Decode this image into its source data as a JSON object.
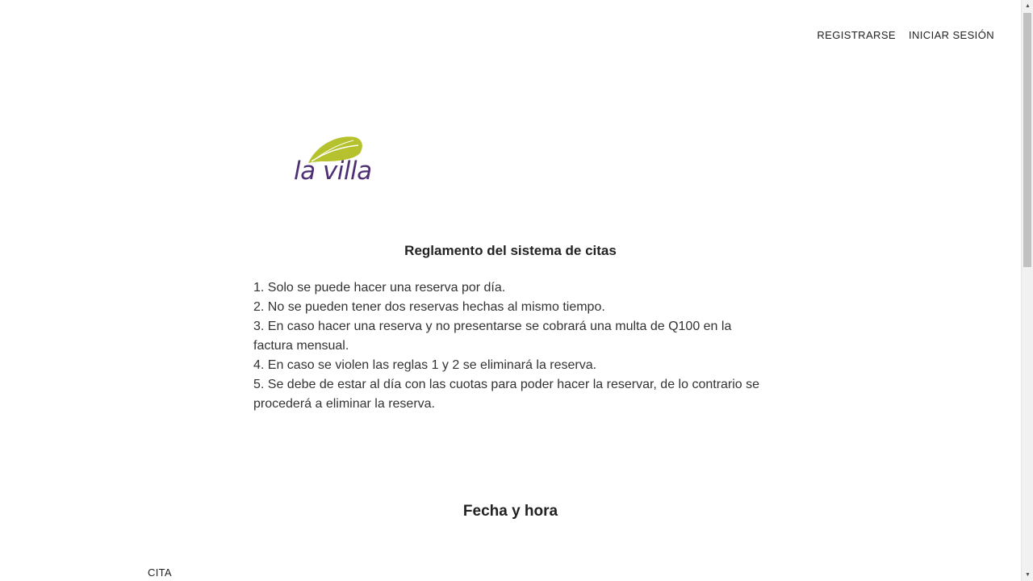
{
  "nav": {
    "register_label": "REGISTRARSE",
    "login_label": "INICIAR SESIÓN"
  },
  "logo": {
    "text": "la villa",
    "leaf_color": "#b5c22d",
    "text_color": "#4e2f73"
  },
  "rules": {
    "title": "Reglamento del sistema de citas",
    "items": [
      "1. Solo se puede hacer una reserva por día.",
      "2. No se pueden tener dos reservas hechas al mismo tiempo.",
      "3. En caso hacer una reserva y no presentarse se cobrará una multa de Q100 en la factura mensual.",
      "4. En caso se violen las reglas 1 y 2 se eliminará la reserva.",
      "5. Se debe de estar al día con las cuotas para poder hacer la reservar, de lo contrario se procederá a eliminar la reserva."
    ]
  },
  "schedule": {
    "title": "Fecha y hora",
    "appointment_label": "CITA"
  }
}
